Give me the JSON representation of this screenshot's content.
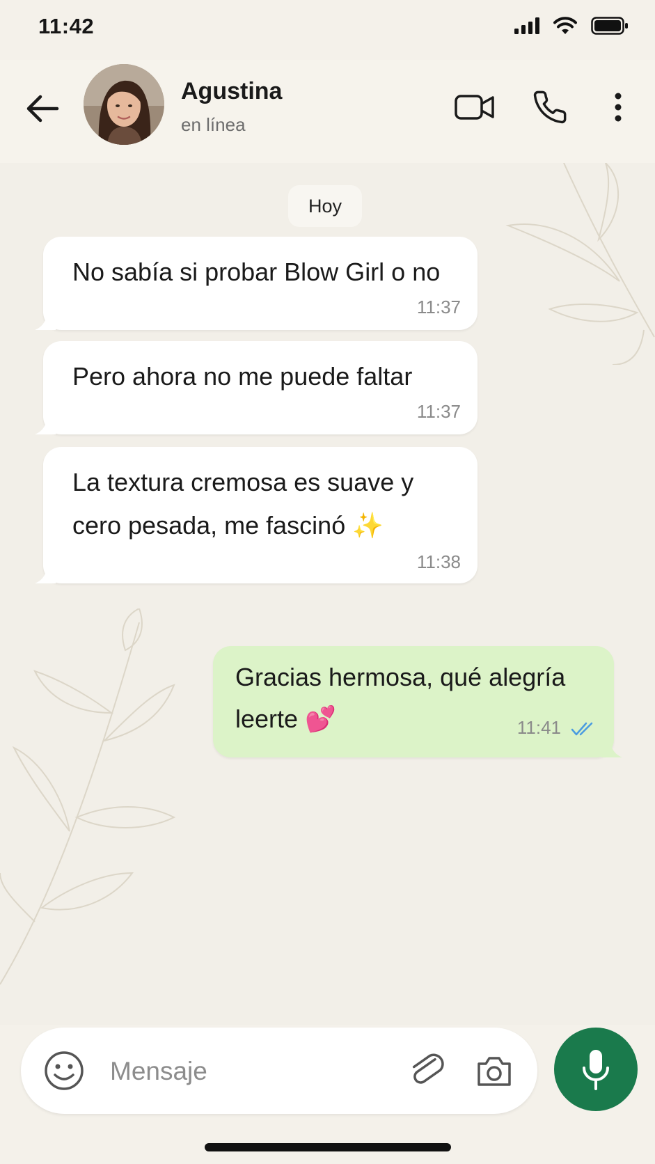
{
  "status_bar": {
    "time": "11:42"
  },
  "header": {
    "contact_name": "Agustina",
    "contact_status": "en línea"
  },
  "chat": {
    "date_divider": "Hoy",
    "messages": [
      {
        "direction": "incoming",
        "lines": [
          "No sabía si probar Blow Girl o no"
        ],
        "time": "11:37"
      },
      {
        "direction": "incoming",
        "lines": [
          "Pero ahora no me puede faltar"
        ],
        "time": "11:37"
      },
      {
        "direction": "incoming",
        "lines": [
          "La textura cremosa es suave y",
          "cero pesada, me fascinó ✨"
        ],
        "time": "11:38"
      },
      {
        "direction": "outgoing",
        "lines": [
          "Gracias hermosa, qué alegría",
          "leerte 💕"
        ],
        "time": "11:41",
        "read": true
      }
    ]
  },
  "composer": {
    "placeholder": "Mensaje"
  },
  "colors": {
    "background": "#f2efe8",
    "incoming_bubble": "#ffffff",
    "outgoing_bubble": "#dcf3c8",
    "mic_button": "#1a7a4c",
    "read_ticks": "#4a9be0"
  },
  "icons": [
    "back-arrow-icon",
    "video-call-icon",
    "phone-icon",
    "more-vert-icon",
    "emoji-icon",
    "attach-icon",
    "camera-icon",
    "mic-icon",
    "double-check-icon"
  ]
}
